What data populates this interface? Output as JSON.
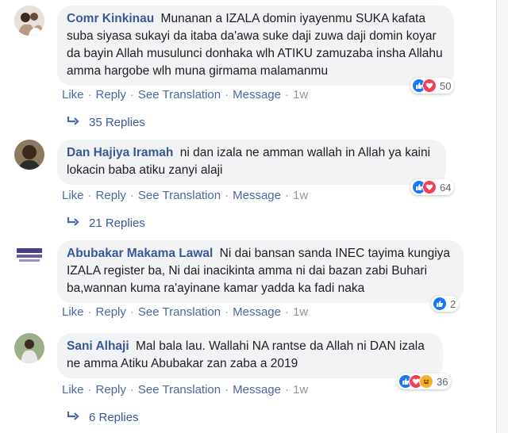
{
  "comments": [
    {
      "author": "Comr Kinkinau",
      "text": "Munanan a IZALA domin iyayenmu SUKA kafata suba siyasa sukayi da itaba da'awa suke daji zuwa daji domin koyar da bayin Allah musulunci donhaka wlh ATIKU zamuzaba insha Allahu amma hargobe wlh muna girmama malamanmu",
      "actions": {
        "like": "Like",
        "reply": "Reply",
        "translate": "See Translation",
        "message": "Message",
        "time": "1w"
      },
      "reaction_count": "50",
      "reactions": [
        "like-icon",
        "love-icon"
      ],
      "replies": "35 Replies"
    },
    {
      "author": "Dan Hajiya Iramah",
      "text": "ni dan izala ne amman wallah in Allah ya kaini lokacin baba atiku zanyi alaji",
      "actions": {
        "like": "Like",
        "reply": "Reply",
        "translate": "See Translation",
        "message": "Message",
        "time": "1w"
      },
      "reaction_count": "64",
      "reactions": [
        "like-icon",
        "love-icon"
      ],
      "replies": "21 Replies"
    },
    {
      "author": "Abubakar Makama Lawal",
      "text": "Ni dai bansan sanda INEC tayima kungiya IZALA register ba, Ni dai inacikinta amma ni dai bazan zabi Buhari ba,wannan kuma ra'ayinane kamar yadda ka fadi naka",
      "actions": {
        "like": "Like",
        "reply": "Reply",
        "translate": "See Translation",
        "message": "Message",
        "time": "1w"
      },
      "reaction_count": "2",
      "reactions": [
        "like-icon"
      ],
      "replies": ""
    },
    {
      "author": "Sani Alhaji",
      "text": "Mal bala lau. Wallahi NA rantse da Allah ni DAN izala ne amma Atiku Abubakar zan zaba a 2019",
      "actions": {
        "like": "Like",
        "reply": "Reply",
        "translate": "See Translation",
        "message": "Message",
        "time": "1w"
      },
      "reaction_count": "36",
      "reactions": [
        "like-icon",
        "love-icon",
        "haha-icon"
      ],
      "replies": "6 Replies"
    }
  ],
  "colors": {
    "link": "#385898",
    "bubble": "#f2f3f5",
    "like": "#1877f2",
    "love": "#f33e58",
    "haha": "#f7b125"
  }
}
